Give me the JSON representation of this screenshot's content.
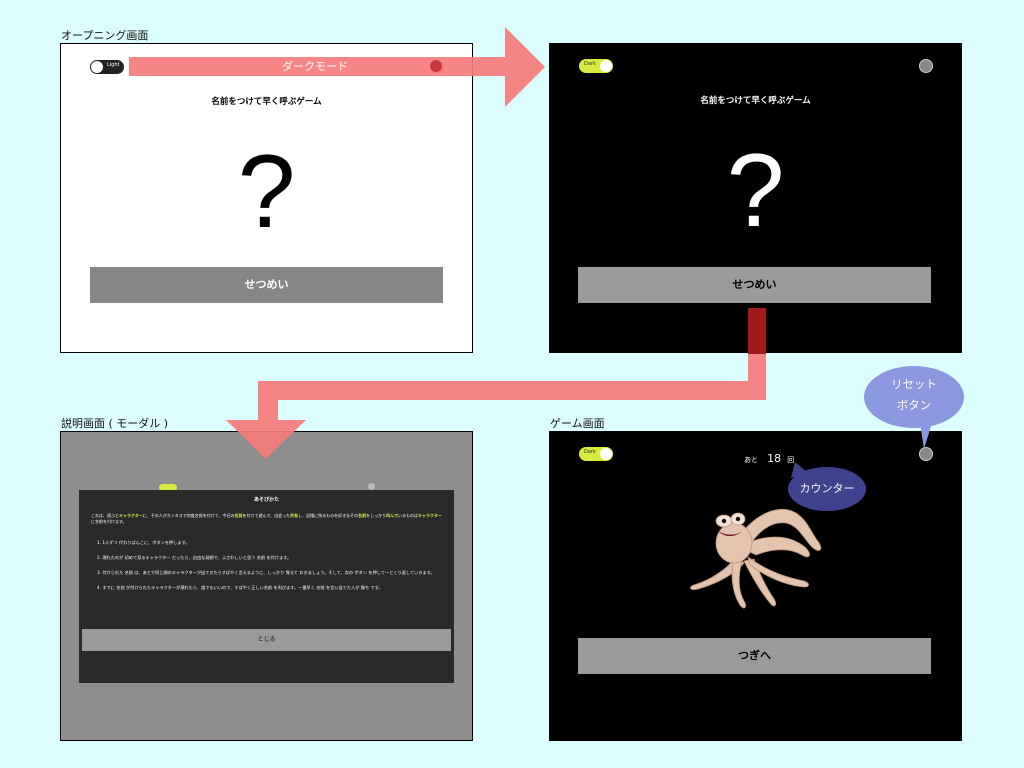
{
  "captions": {
    "opening": "オープニング画面",
    "explain": "説明画面 ( モーダル )",
    "game": "ゲーム画面"
  },
  "annotations": {
    "dark_mode": "ダークモード",
    "reset_bubble": [
      "リセット",
      "ボタン"
    ],
    "counter_bubble": "カウンター"
  },
  "opening": {
    "toggle_label": "Light",
    "title": "名前をつけて早く呼ぶゲーム",
    "question_mark": "?",
    "explain_button": "せつめい"
  },
  "opening_dark": {
    "toggle_label": "Dark",
    "title": "名前をつけて早く呼ぶゲーム",
    "question_mark": "?",
    "explain_button": "せつめい"
  },
  "modal": {
    "title": "あそびかた",
    "intro": [
      "これは、遊ぶと",
      "キャラクター",
      "に、その人がカンタスで何度名前を付けて、今日の",
      "名前",
      "を付けて遊んで、出会った",
      "共有",
      "し、記憶に残るものを好きなその",
      "名前",
      "をしっかり",
      "叫んで",
      "いるものは",
      "キャラクター",
      "に名前を付けます。"
    ],
    "steps": [
      "1. 1人ずつ 代わりばんこに、ボタンを押します。",
      "2. 現れたのが 初めて見るキャラクター だったら、自由な発想で、ふさわしいと思う 名前 を付けます。",
      "3. 付けられた 名前 は、あとで同じ顔のキャラクターが出てきたらすばやく言えるように、しっかり 覚えて おきましょう。そして、次の ボタン を押して一とくり返していきます。",
      "4. すでに 名前 が付けられたキャラクターが現れたら、誰でもいいので、すばやく正しい名前 を叫びます。一番早く 名前 を言い当てた人が 勝ち です。"
    ],
    "close_button": "とじる"
  },
  "game": {
    "toggle_label": "Dark",
    "counter_prefix": "あと",
    "counter_value": "18",
    "counter_suffix": "回",
    "next_button": "つぎへ"
  },
  "colors": {
    "background": "#dbfdfd",
    "arrow": "#f57b7b",
    "toggle_on": "#d6ea3f",
    "bubble": "#8b98e0",
    "counter_bubble": "#3f438f",
    "button_gray": "#9a9a9a"
  }
}
